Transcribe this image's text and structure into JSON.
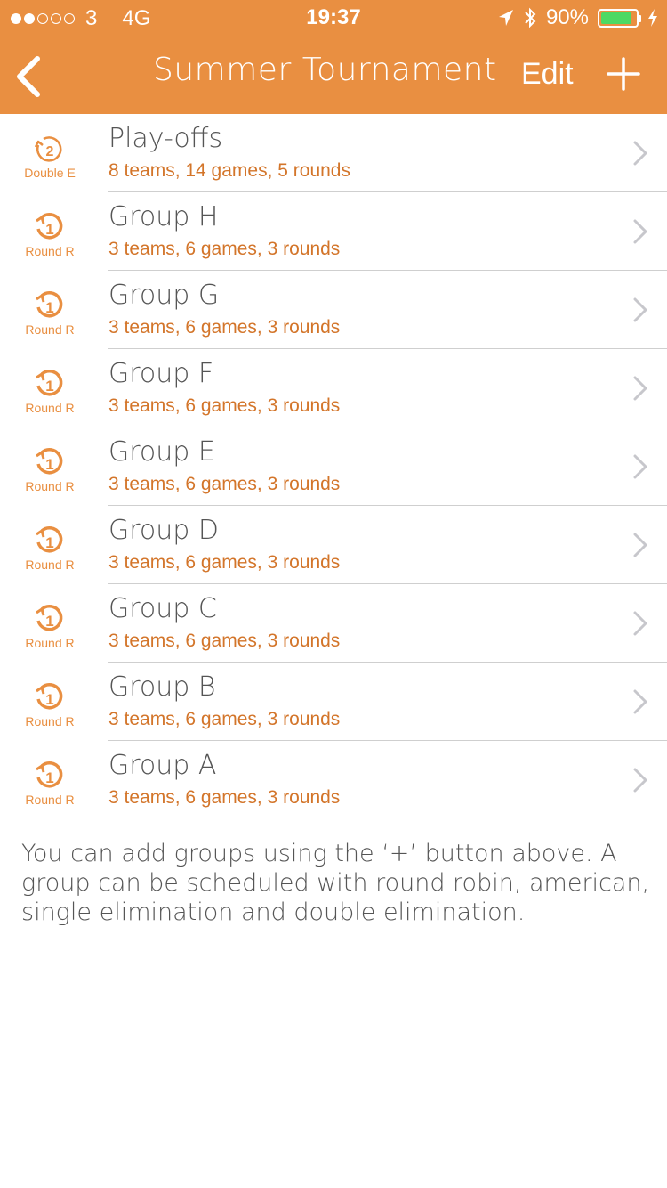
{
  "status_bar": {
    "carrier": "3",
    "network": "4G",
    "time": "19:37",
    "battery": "90%",
    "signal_bars_filled": 2,
    "signal_bars_total": 5
  },
  "nav": {
    "title": "Summer Tournament",
    "edit_label": "Edit"
  },
  "colors": {
    "accent": "#E98F41",
    "subtitle": "#D3752A",
    "text": "#555555",
    "divider": "#CFCFCF"
  },
  "groups": [
    {
      "title": "Play-offs",
      "subtitle": "8 teams, 14 games, 5 rounds",
      "icon_number": "2",
      "type_label": "Double E",
      "icon": "double-elimination-icon"
    },
    {
      "title": "Group H",
      "subtitle": "3 teams, 6 games, 3 rounds",
      "icon_number": "1",
      "type_label": "Round R",
      "icon": "round-robin-icon"
    },
    {
      "title": "Group G",
      "subtitle": "3 teams, 6 games, 3 rounds",
      "icon_number": "1",
      "type_label": "Round R",
      "icon": "round-robin-icon"
    },
    {
      "title": "Group F",
      "subtitle": "3 teams, 6 games, 3 rounds",
      "icon_number": "1",
      "type_label": "Round R",
      "icon": "round-robin-icon"
    },
    {
      "title": "Group E",
      "subtitle": "3 teams, 6 games, 3 rounds",
      "icon_number": "1",
      "type_label": "Round R",
      "icon": "round-robin-icon"
    },
    {
      "title": "Group D",
      "subtitle": "3 teams, 6 games, 3 rounds",
      "icon_number": "1",
      "type_label": "Round R",
      "icon": "round-robin-icon"
    },
    {
      "title": "Group C",
      "subtitle": "3 teams, 6 games, 3 rounds",
      "icon_number": "1",
      "type_label": "Round R",
      "icon": "round-robin-icon"
    },
    {
      "title": "Group B",
      "subtitle": "3 teams, 6 games, 3 rounds",
      "icon_number": "1",
      "type_label": "Round R",
      "icon": "round-robin-icon"
    },
    {
      "title": "Group A",
      "subtitle": "3 teams, 6 games, 3 rounds",
      "icon_number": "1",
      "type_label": "Round R",
      "icon": "round-robin-icon"
    }
  ],
  "help_text": "You can add groups using the ‘+’ button above. A group can be scheduled with round robin, american, single elimination and double elimination."
}
